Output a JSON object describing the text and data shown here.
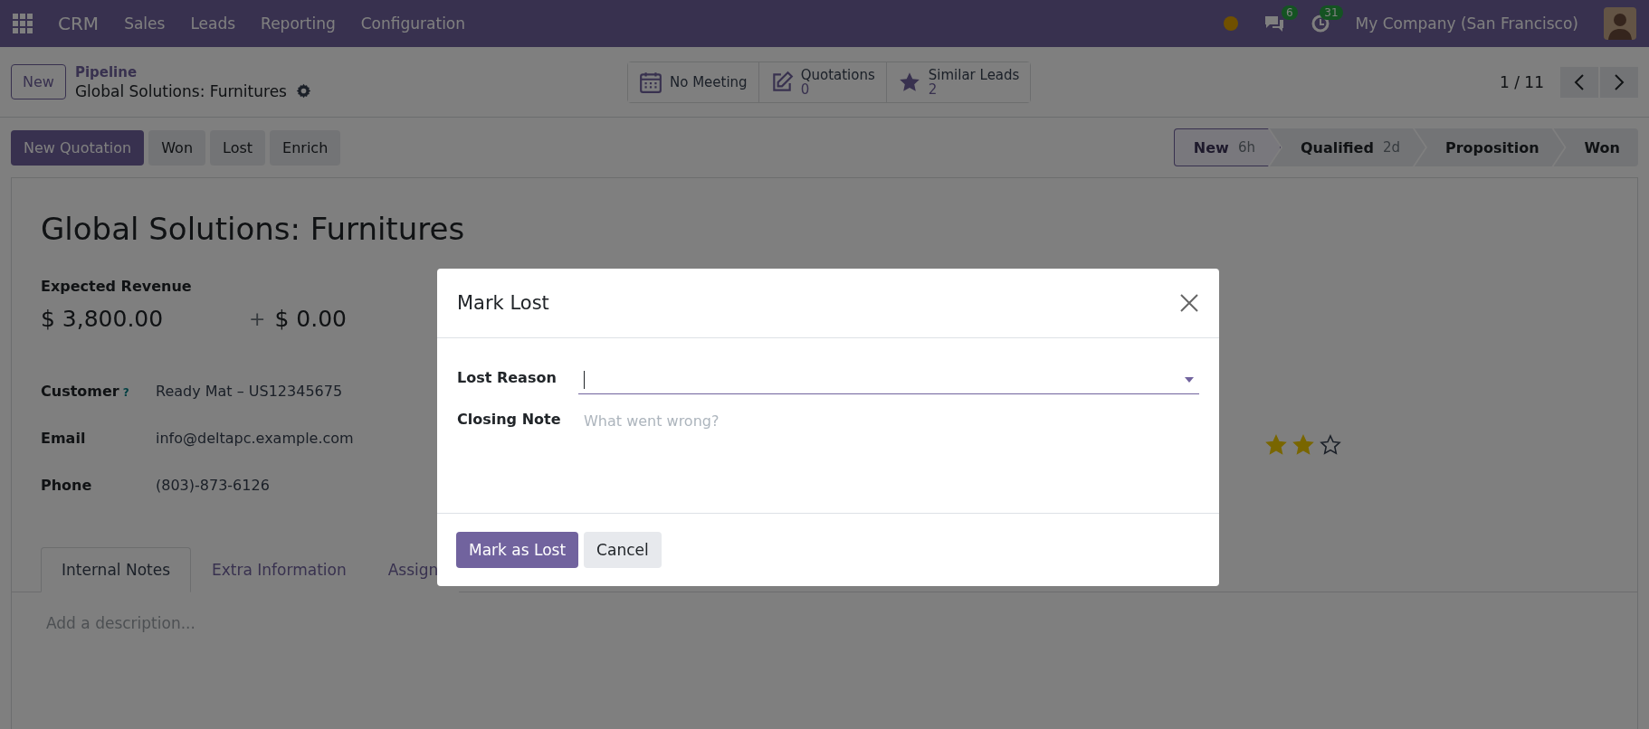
{
  "navbar": {
    "app": "CRM",
    "menus": [
      "Sales",
      "Leads",
      "Reporting",
      "Configuration"
    ],
    "messages_count": "6",
    "activities_count": "31",
    "company": "My Company (San Francisco)"
  },
  "control_panel": {
    "new_button": "New",
    "breadcrumb": "Pipeline",
    "record": "Global Solutions: Furnitures",
    "smart_buttons": [
      {
        "kind": "calendar",
        "label": "No Meeting"
      },
      {
        "kind": "edit",
        "label": "Quotations",
        "count": "0"
      },
      {
        "kind": "star",
        "label": "Similar Leads",
        "count": "2"
      }
    ],
    "pager": "1 / 11"
  },
  "actions": [
    {
      "label": "New Quotation",
      "primary": true
    },
    {
      "label": "Won",
      "primary": false
    },
    {
      "label": "Lost",
      "primary": false
    },
    {
      "label": "Enrich",
      "primary": false
    }
  ],
  "stages": [
    {
      "label": "New",
      "duration": "6h",
      "selected": true
    },
    {
      "label": "Qualified",
      "duration": "2d",
      "selected": false
    },
    {
      "label": "Proposition",
      "selected": false
    },
    {
      "label": "Won",
      "selected": false
    }
  ],
  "form": {
    "title": "Global Solutions: Furnitures",
    "revenue_label": "Expected Revenue",
    "revenue": "$ 3,800.00",
    "plus": "+",
    "recurring": "$ 0.00",
    "fields": [
      {
        "label": "Customer",
        "help": "?",
        "value": "Ready Mat – US12345675"
      },
      {
        "label": "Email",
        "value": "info@deltapc.example.com"
      },
      {
        "label": "Phone",
        "value": "(803)-873-6126"
      }
    ],
    "stars": 2,
    "tabs": [
      {
        "label": "Internal Notes",
        "selected": true
      },
      {
        "label": "Extra Information",
        "selected": false
      },
      {
        "label": "Assign",
        "selected": false
      }
    ],
    "description_placeholder": "Add a description..."
  },
  "dialog": {
    "title": "Mark Lost",
    "fields": [
      {
        "label": "Lost Reason",
        "kind": "select"
      },
      {
        "label": "Closing Note",
        "kind": "note",
        "placeholder": "What went wrong?"
      }
    ],
    "buttons": [
      {
        "label": "Mark as Lost",
        "primary": true
      },
      {
        "label": "Cancel",
        "primary": false
      }
    ]
  }
}
